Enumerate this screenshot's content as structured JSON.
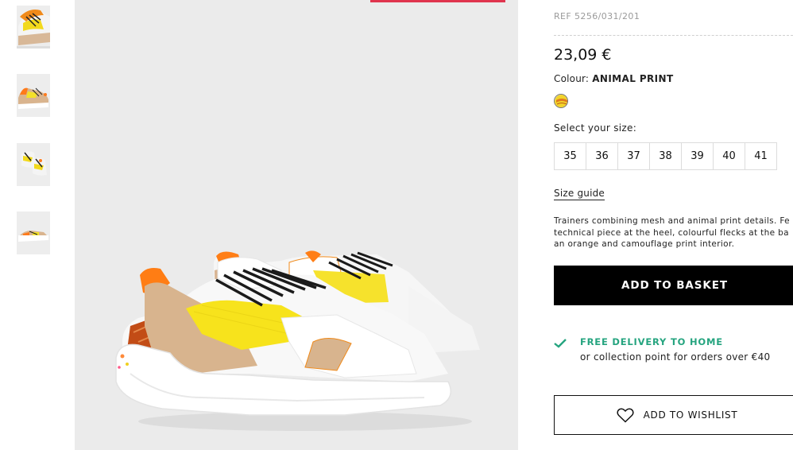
{
  "gallery": {
    "thumbnails": [
      {
        "alt": "trainer view 1"
      },
      {
        "alt": "trainer view 2"
      },
      {
        "alt": "trainer view 3"
      },
      {
        "alt": "trainer view 4"
      }
    ],
    "main_image_alt": "Trainers with animal print details"
  },
  "product": {
    "ref": "REF 5256/031/201",
    "price": "23,09 €",
    "colour_label": "Colour:",
    "colour_value": "ANIMAL PRINT",
    "size_label": "Select your size:",
    "sizes": [
      "35",
      "36",
      "37",
      "38",
      "39",
      "40",
      "41"
    ],
    "size_guide": "Size guide",
    "description_lines": [
      "Trainers combining mesh and animal print details. Fe",
      "technical piece at the heel, colourful flecks at the ba",
      "an orange and camouflage print interior."
    ],
    "add_to_basket": "ADD TO BASKET",
    "delivery_title": "FREE DELIVERY TO HOME",
    "delivery_sub": "or collection point for orders over €40",
    "add_to_wishlist": "ADD TO WISHLIST"
  },
  "icons": {
    "check": "check-icon",
    "heart": "heart-icon"
  },
  "colors": {
    "accent_red": "#e0344e",
    "delivery_green": "#25a47f",
    "button_black": "#000000"
  }
}
